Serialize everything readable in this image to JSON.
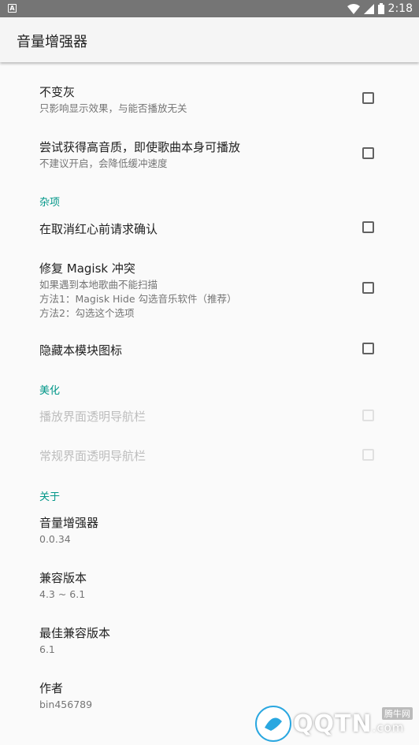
{
  "status": {
    "time": "2:18"
  },
  "app": {
    "title": "音量增强器"
  },
  "prefs": {
    "no_gray": {
      "title": "不变灰",
      "summary": "只影响显示效果，与能否播放无关"
    },
    "hq": {
      "title": "尝试获得高音质，即使歌曲本身可播放",
      "summary": "不建议开启，会降低缓冲速度"
    },
    "misc_header": "杂项",
    "confirm": {
      "title": "在取消红心前请求确认"
    },
    "magisk": {
      "title": "修复 Magisk 冲突",
      "summary1": "如果遇到本地歌曲不能扫描",
      "summary2": "方法1：Magisk Hide 勾选音乐软件（推荐）",
      "summary3": "方法2：勾选这个选项"
    },
    "hide_icon": {
      "title": "隐藏本模块图标"
    },
    "beauty_header": "美化",
    "play_nav": {
      "title": "播放界面透明导航栏"
    },
    "normal_nav": {
      "title": "常规界面透明导航栏"
    },
    "about_header": "关于",
    "app_name": {
      "title": "音量增强器",
      "value": "0.0.34"
    },
    "compat": {
      "title": "兼容版本",
      "value": "4.3 ~ 6.1"
    },
    "best": {
      "title": "最佳兼容版本",
      "value": "6.1"
    },
    "author": {
      "title": "作者",
      "value": "bin456789"
    }
  },
  "watermark": {
    "brand": "QQTN",
    "suffix": ".com",
    "tag": "腾牛网"
  },
  "colors": {
    "accent": "#009688",
    "statusbar": "#757575"
  }
}
